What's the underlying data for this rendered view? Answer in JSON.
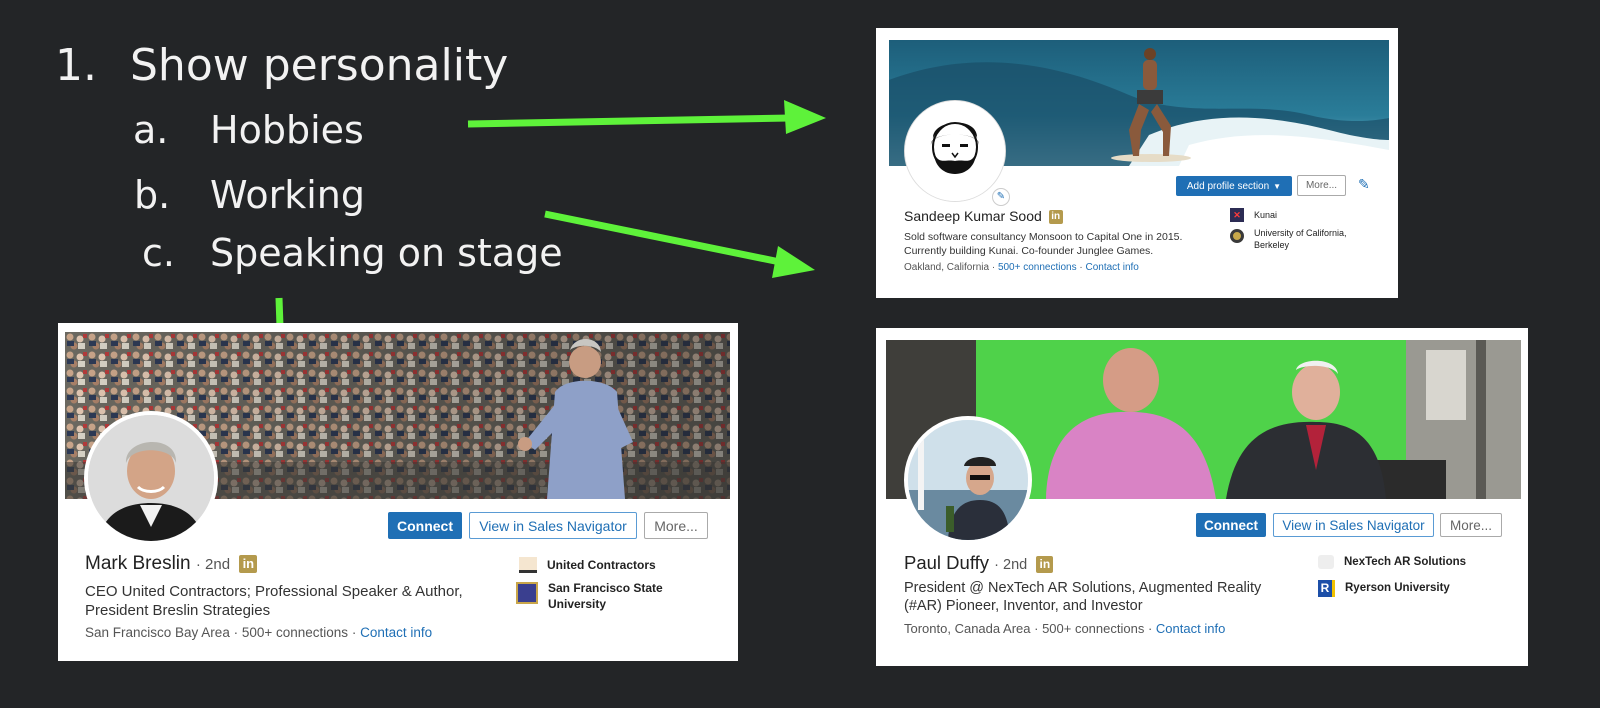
{
  "outline": {
    "item1_num": "1.",
    "item1_text": "Show personality",
    "subitems": [
      {
        "letter": "a.",
        "text": "Hobbies"
      },
      {
        "letter": "b.",
        "text": "Working"
      },
      {
        "letter": "c.",
        "text": "Speaking on stage"
      }
    ]
  },
  "colors": {
    "background": "#232527",
    "arrow": "#5ef23a",
    "linkedin_blue": "#1f6fb5",
    "premium_gold": "#b49a4d"
  },
  "profile_sandeep": {
    "name": "Sandeep Kumar Sood",
    "premium_badge": "in",
    "headline_line1": "Sold software consultancy Monsoon to Capital One in 2015.",
    "headline_line2": "Currently building Kunai. Co-founder Junglee Games.",
    "location": "Oakland, California",
    "connections": "500+ connections",
    "contact": "Contact info",
    "add_section_btn": "Add profile section",
    "more_btn": "More...",
    "company": "Kunai",
    "school_line1": "University of California,",
    "school_line2": "Berkeley"
  },
  "profile_mark": {
    "name": "Mark Breslin",
    "degree": "2nd",
    "premium_badge": "in",
    "headline_line1": "CEO United Contractors; Professional Speaker & Author,",
    "headline_line2": "President Breslin Strategies",
    "location": "San Francisco Bay Area",
    "connections": "500+ connections",
    "contact": "Contact info",
    "connect_btn": "Connect",
    "sales_nav_btn": "View in Sales Navigator",
    "more_btn": "More...",
    "company": "United Contractors",
    "school_line1": "San Francisco State",
    "school_line2": "University"
  },
  "profile_paul": {
    "name": "Paul Duffy",
    "degree": "2nd",
    "premium_badge": "in",
    "headline_line1": "President @ NexTech AR Solutions, Augmented Reality",
    "headline_line2": "(#AR) Pioneer, Inventor, and Investor",
    "location": "Toronto, Canada Area",
    "connections": "500+ connections",
    "contact": "Contact info",
    "connect_btn": "Connect",
    "sales_nav_btn": "View in Sales Navigator",
    "more_btn": "More...",
    "company": "NexTech AR Solutions",
    "school": "Ryerson University",
    "school_logo_letter": "R"
  }
}
